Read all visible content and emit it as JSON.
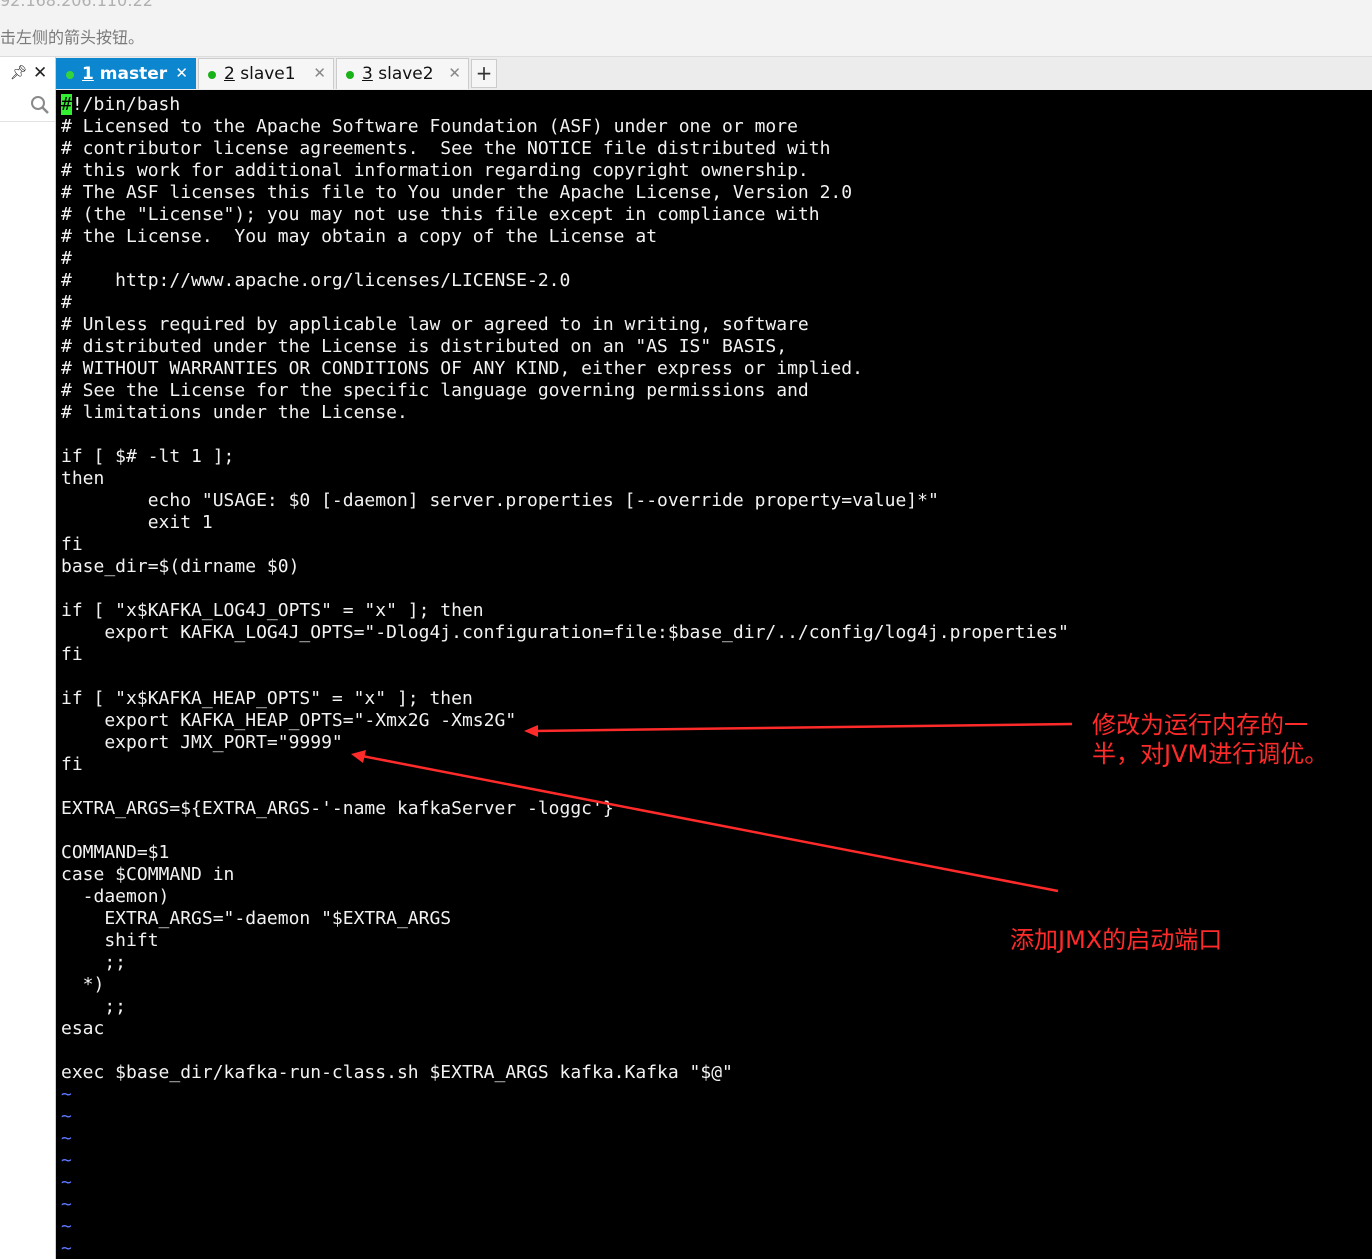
{
  "window": {
    "host_partial": "92.168.206.110:22",
    "hint": "击左侧的箭头按钮。"
  },
  "side_panel": {
    "pin_icon": "pin-icon",
    "close_icon": "close-icon",
    "search_icon": "search-icon"
  },
  "tabs": [
    {
      "num": "1",
      "name": "master",
      "active": true
    },
    {
      "num": "2",
      "name": "slave1",
      "active": false
    },
    {
      "num": "3",
      "name": "slave2",
      "active": false
    }
  ],
  "add_tab_label": "+",
  "terminal": {
    "cursor_char": "#",
    "text": "!/bin/bash\n# Licensed to the Apache Software Foundation (ASF) under one or more\n# contributor license agreements.  See the NOTICE file distributed with\n# this work for additional information regarding copyright ownership.\n# The ASF licenses this file to You under the Apache License, Version 2.0\n# (the \"License\"); you may not use this file except in compliance with\n# the License.  You may obtain a copy of the License at\n#\n#    http://www.apache.org/licenses/LICENSE-2.0\n#\n# Unless required by applicable law or agreed to in writing, software\n# distributed under the License is distributed on an \"AS IS\" BASIS,\n# WITHOUT WARRANTIES OR CONDITIONS OF ANY KIND, either express or implied.\n# See the License for the specific language governing permissions and\n# limitations under the License.\n\nif [ $# -lt 1 ];\nthen\n        echo \"USAGE: $0 [-daemon] server.properties [--override property=value]*\"\n        exit 1\nfi\nbase_dir=$(dirname $0)\n\nif [ \"x$KAFKA_LOG4J_OPTS\" = \"x\" ]; then\n    export KAFKA_LOG4J_OPTS=\"-Dlog4j.configuration=file:$base_dir/../config/log4j.properties\"\nfi\n\nif [ \"x$KAFKA_HEAP_OPTS\" = \"x\" ]; then\n    export KAFKA_HEAP_OPTS=\"-Xmx2G -Xms2G\"\n    export JMX_PORT=\"9999\"\nfi\n\nEXTRA_ARGS=${EXTRA_ARGS-'-name kafkaServer -loggc'}\n\nCOMMAND=$1\ncase $COMMAND in\n  -daemon)\n    EXTRA_ARGS=\"-daemon \"$EXTRA_ARGS\n    shift\n    ;;\n  *)\n    ;;\nesac\n\nexec $base_dir/kafka-run-class.sh $EXTRA_ARGS kafka.Kafka \"$@\"\n",
    "tilde_lines": [
      "~",
      "~",
      "~",
      "~",
      "~",
      "~",
      "~",
      "~"
    ]
  },
  "annotations": {
    "heap_note_line1": "修改为运行内存的一",
    "heap_note_line2": "半，对JVM进行调优。",
    "jmx_note": "添加JMX的启动端口",
    "color": "#ff2a2a"
  }
}
